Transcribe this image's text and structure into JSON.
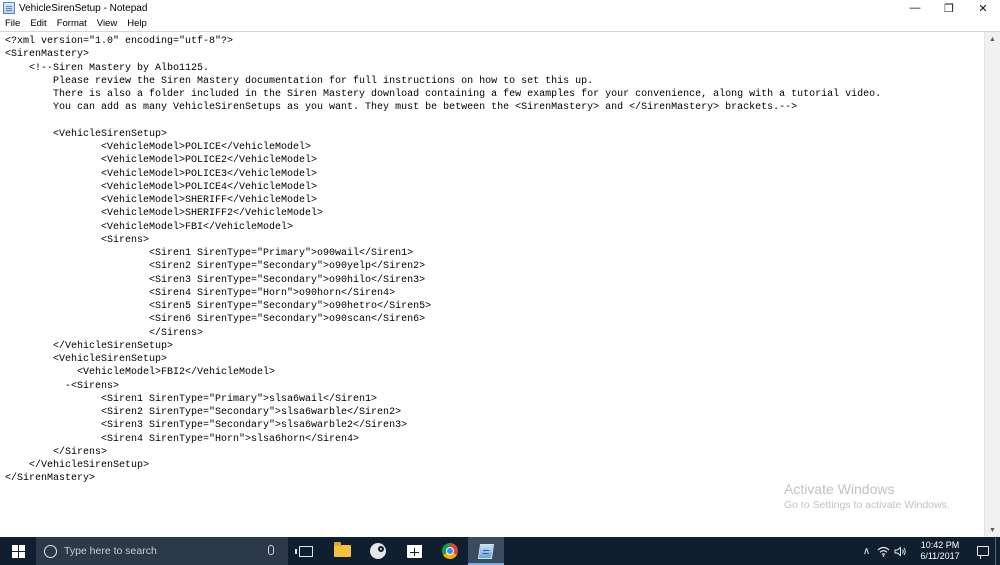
{
  "window": {
    "title": "VehicleSirenSetup - Notepad",
    "controls": {
      "minimize": "—",
      "maximize": "❐",
      "close": "✕"
    }
  },
  "menu": [
    "File",
    "Edit",
    "Format",
    "View",
    "Help"
  ],
  "editor": {
    "lines": [
      "<?xml version=\"1.0\" encoding=\"utf-8\"?>",
      "<SirenMastery>",
      "    <!--Siren Mastery by Albo1125.",
      "        Please review the Siren Mastery documentation for full instructions on how to set this up.",
      "        There is also a folder included in the Siren Mastery download containing a few examples for your convenience, along with a tutorial video.",
      "        You can add as many VehicleSirenSetups as you want. They must be between the <SirenMastery> and </SirenMastery> brackets.-->",
      "",
      "        <VehicleSirenSetup>",
      "                <VehicleModel>POLICE</VehicleModel>",
      "                <VehicleModel>POLICE2</VehicleModel>",
      "                <VehicleModel>POLICE3</VehicleModel>",
      "                <VehicleModel>POLICE4</VehicleModel>",
      "                <VehicleModel>SHERIFF</VehicleModel>",
      "                <VehicleModel>SHERIFF2</VehicleModel>",
      "                <VehicleModel>FBI</VehicleModel>",
      "                <Sirens>",
      "                        <Siren1 SirenType=\"Primary\">o90wail</Siren1>",
      "                        <Siren2 SirenType=\"Secondary\">o90yelp</Siren2>",
      "                        <Siren3 SirenType=\"Secondary\">o90hilo</Siren3>",
      "                        <Siren4 SirenType=\"Horn\">o90horn</Siren4>",
      "                        <Siren5 SirenType=\"Secondary\">o90hetro</Siren5>",
      "                        <Siren6 SirenType=\"Secondary\">o90scan</Siren6>",
      "                        </Sirens>",
      "        </VehicleSirenSetup>",
      "        <VehicleSirenSetup>",
      "            <VehicleModel>FBI2</VehicleModel>",
      "          -<Sirens>",
      "                <Siren1 SirenType=\"Primary\">slsa6wail</Siren1>",
      "                <Siren2 SirenType=\"Secondary\">slsa6warble</Siren2>",
      "                <Siren3 SirenType=\"Secondary\">slsa6warble2</Siren3>",
      "                <Siren4 SirenType=\"Horn\">slsa6horn</Siren4>",
      "        </Sirens>",
      "    </VehicleSirenSetup>",
      "</SirenMastery>"
    ]
  },
  "watermark": {
    "title": "Activate Windows",
    "subtitle": "Go to Settings to activate Windows."
  },
  "taskbar": {
    "search_placeholder": "Type here to search",
    "apps": [
      "task-view",
      "file-explorer",
      "steam",
      "store",
      "chrome",
      "notepad"
    ],
    "tray": {
      "chevron": "∧",
      "time": "10:42 PM",
      "date": "6/11/2017"
    }
  }
}
